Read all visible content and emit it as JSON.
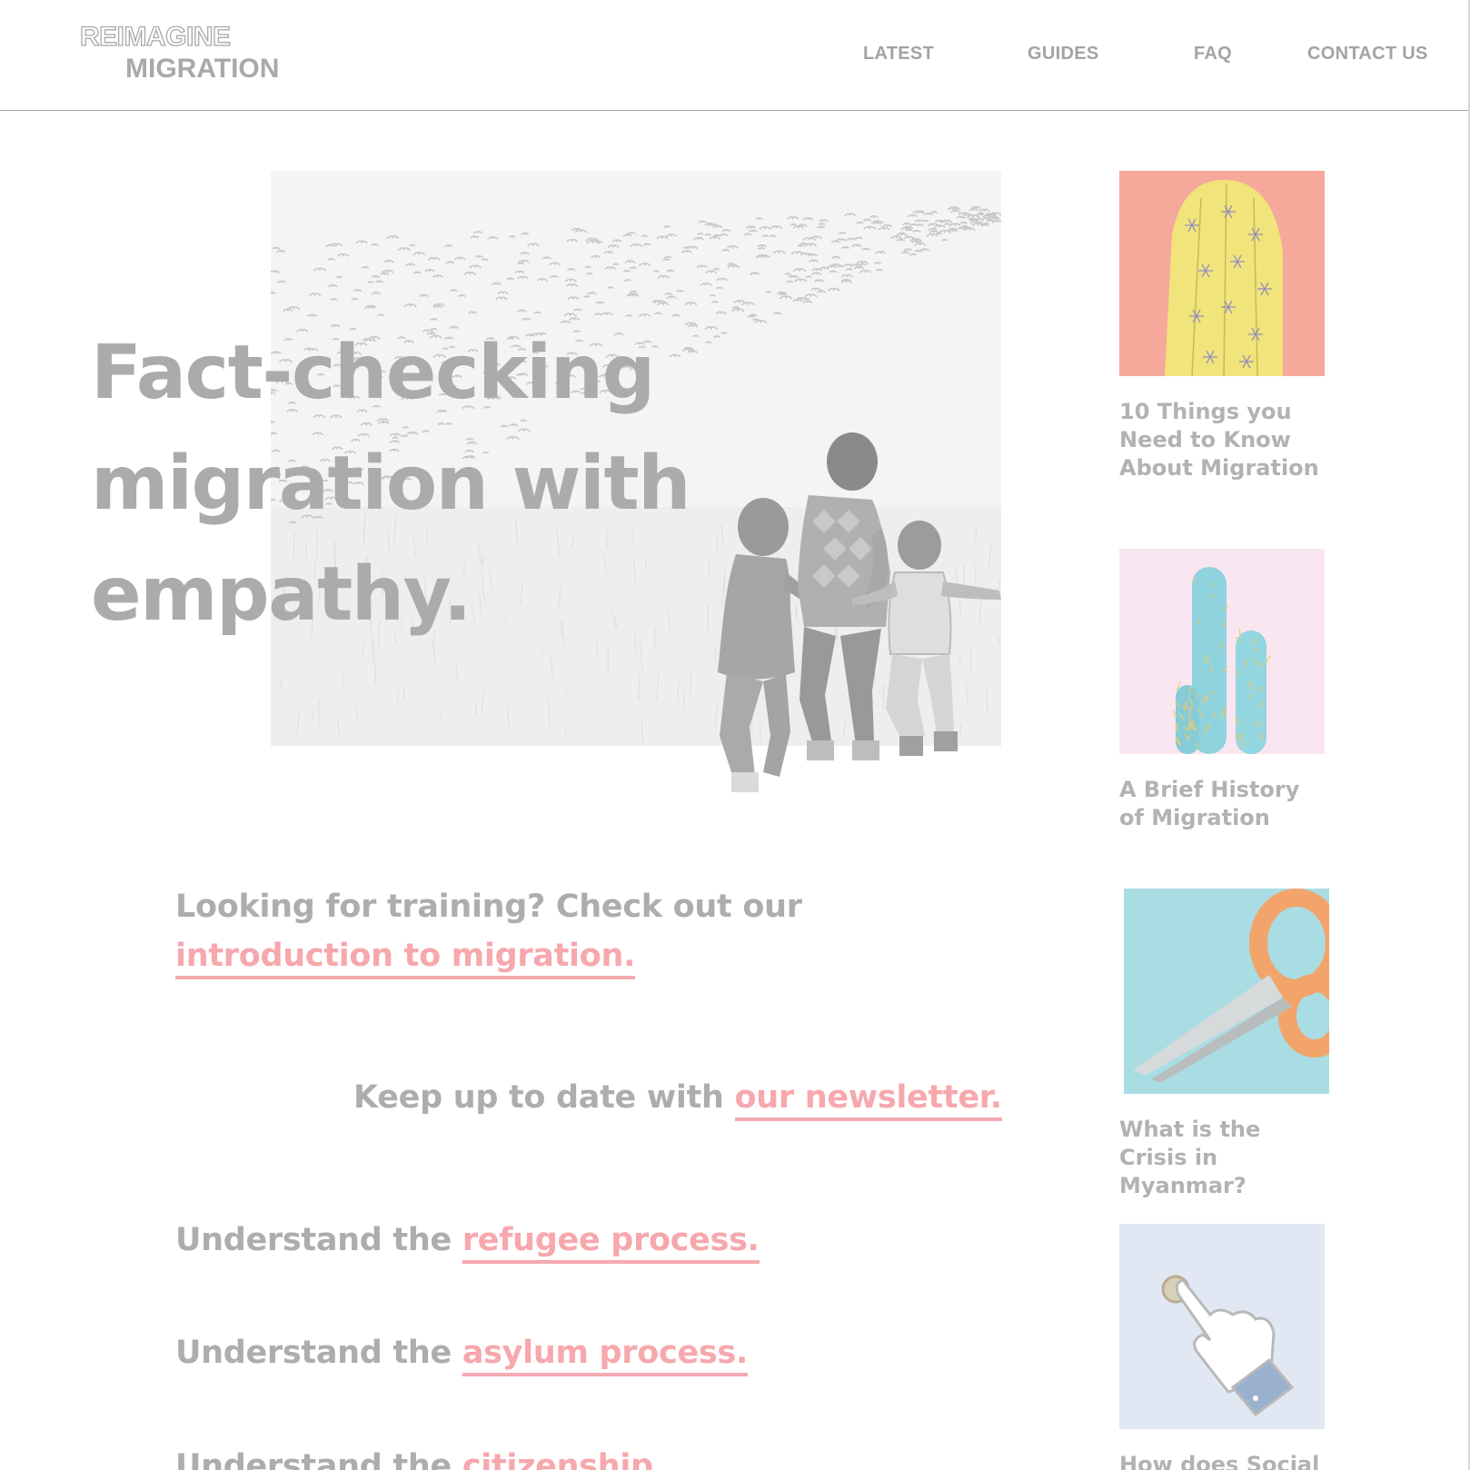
{
  "header": {
    "logo_top": "REIMAGINE",
    "logo_bottom": "MIGRATION",
    "nav": [
      "LATEST",
      "GUIDES",
      "FAQ",
      "CONTACT US"
    ]
  },
  "hero": {
    "title": "Fact-checking migration with empathy."
  },
  "ctas": [
    {
      "text": "Looking for training? Check out our ",
      "link": "introduction to migration."
    },
    {
      "text": "Keep up to date with ",
      "link": "our newsletter."
    },
    {
      "text": "Understand the ",
      "link": "refugee process."
    },
    {
      "text": "Understand the ",
      "link": "asylum process."
    },
    {
      "text": "Understand the ",
      "link": "citizenship"
    }
  ],
  "sidebar": {
    "cards": [
      {
        "title": "10 Things you Need to Know About Migration",
        "image": "yellow-cactus-on-coral"
      },
      {
        "title": "A Brief History of Migration",
        "image": "blue-cacti-on-pink"
      },
      {
        "title": "What is the Crisis in Myanmar?",
        "image": "orange-scissors-on-teal"
      },
      {
        "title": "How does Social",
        "image": "hand-pressing-doorbell"
      }
    ]
  },
  "colors": {
    "text_gray": "#adadad",
    "link_pink": "#f6a8ad",
    "border": "#a9a9a9"
  }
}
